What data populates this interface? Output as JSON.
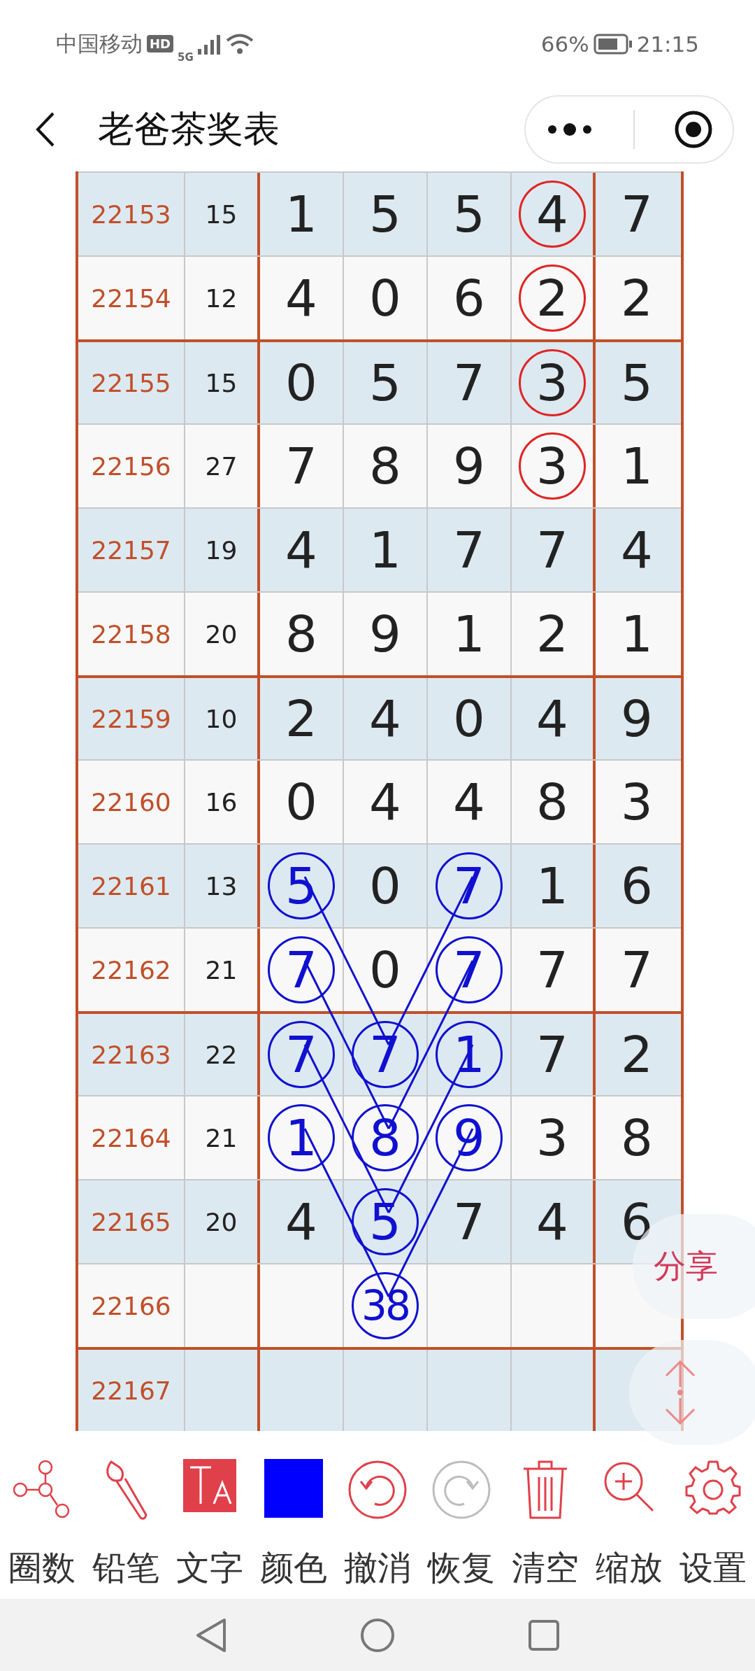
{
  "status_bar": {
    "carrier": "中国移动",
    "network_badge": "HD",
    "network_type": "5G",
    "battery": "66%",
    "time": "21:15"
  },
  "nav": {
    "title": "老爸茶奖表"
  },
  "table": {
    "rows": [
      {
        "period": "22153",
        "sum": "15",
        "digits": [
          {
            "text": "1",
            "circled": false
          },
          {
            "text": "5",
            "circled": false
          },
          {
            "text": "5",
            "circled": false
          },
          {
            "text": "4",
            "circled": true,
            "color": "#e02424"
          },
          {
            "text": "7",
            "circled": false
          }
        ]
      },
      {
        "period": "22154",
        "sum": "12",
        "digits": [
          {
            "text": "4",
            "circled": false
          },
          {
            "text": "0",
            "circled": false
          },
          {
            "text": "6",
            "circled": false
          },
          {
            "text": "2",
            "circled": true,
            "color": "#e02424"
          },
          {
            "text": "2",
            "circled": false
          }
        ]
      },
      {
        "period": "22155",
        "sum": "15",
        "digits": [
          {
            "text": "0",
            "circled": false
          },
          {
            "text": "5",
            "circled": false
          },
          {
            "text": "7",
            "circled": false
          },
          {
            "text": "3",
            "circled": true,
            "color": "#e02424"
          },
          {
            "text": "5",
            "circled": false
          }
        ]
      },
      {
        "period": "22156",
        "sum": "27",
        "digits": [
          {
            "text": "7",
            "circled": false
          },
          {
            "text": "8",
            "circled": false
          },
          {
            "text": "9",
            "circled": false
          },
          {
            "text": "3",
            "circled": true,
            "color": "#e02424"
          },
          {
            "text": "1",
            "circled": false
          }
        ]
      },
      {
        "period": "22157",
        "sum": "19",
        "digits": [
          {
            "text": "4",
            "circled": false
          },
          {
            "text": "1",
            "circled": false
          },
          {
            "text": "7",
            "circled": false
          },
          {
            "text": "7",
            "circled": false
          },
          {
            "text": "4",
            "circled": false
          }
        ]
      },
      {
        "period": "22158",
        "sum": "20",
        "digits": [
          {
            "text": "8",
            "circled": false
          },
          {
            "text": "9",
            "circled": false
          },
          {
            "text": "1",
            "circled": false
          },
          {
            "text": "2",
            "circled": false
          },
          {
            "text": "1",
            "circled": false
          }
        ]
      },
      {
        "period": "22159",
        "sum": "10",
        "digits": [
          {
            "text": "2",
            "circled": false
          },
          {
            "text": "4",
            "circled": false
          },
          {
            "text": "0",
            "circled": false
          },
          {
            "text": "4",
            "circled": false
          },
          {
            "text": "9",
            "circled": false
          }
        ]
      },
      {
        "period": "22160",
        "sum": "16",
        "digits": [
          {
            "text": "0",
            "circled": false
          },
          {
            "text": "4",
            "circled": false
          },
          {
            "text": "4",
            "circled": false
          },
          {
            "text": "8",
            "circled": false
          },
          {
            "text": "3",
            "circled": false
          }
        ]
      },
      {
        "period": "22161",
        "sum": "13",
        "digits": [
          {
            "text": "5",
            "circled": true,
            "color": "#1010d0"
          },
          {
            "text": "0",
            "circled": false
          },
          {
            "text": "7",
            "circled": true,
            "color": "#1010d0"
          },
          {
            "text": "1",
            "circled": false
          },
          {
            "text": "6",
            "circled": false
          }
        ]
      },
      {
        "period": "22162",
        "sum": "21",
        "digits": [
          {
            "text": "7",
            "circled": true,
            "color": "#1010d0"
          },
          {
            "text": "0",
            "circled": false
          },
          {
            "text": "7",
            "circled": true,
            "color": "#1010d0"
          },
          {
            "text": "7",
            "circled": false
          },
          {
            "text": "7",
            "circled": false
          }
        ]
      },
      {
        "period": "22163",
        "sum": "22",
        "digits": [
          {
            "text": "7",
            "circled": true,
            "color": "#1010d0"
          },
          {
            "text": "7",
            "circled": true,
            "color": "#1010d0"
          },
          {
            "text": "1",
            "circled": true,
            "color": "#1010d0"
          },
          {
            "text": "7",
            "circled": false
          },
          {
            "text": "2",
            "circled": false
          }
        ]
      },
      {
        "period": "22164",
        "sum": "21",
        "digits": [
          {
            "text": "1",
            "circled": true,
            "color": "#1010d0"
          },
          {
            "text": "8",
            "circled": true,
            "color": "#1010d0"
          },
          {
            "text": "9",
            "circled": true,
            "color": "#1010d0"
          },
          {
            "text": "3",
            "circled": false
          },
          {
            "text": "8",
            "circled": false
          }
        ]
      },
      {
        "period": "22165",
        "sum": "20",
        "digits": [
          {
            "text": "4",
            "circled": false
          },
          {
            "text": "5",
            "circled": true,
            "color": "#1010d0"
          },
          {
            "text": "7",
            "circled": false
          },
          {
            "text": "4",
            "circled": false
          },
          {
            "text": "6",
            "circled": false
          }
        ]
      },
      {
        "period": "22166",
        "digits": [
          {
            "circled": false
          },
          {
            "text": "38",
            "circled": true,
            "color": "#1010d0"
          },
          {
            "circled": false
          },
          {
            "circled": false
          },
          {
            "circled": false
          }
        ]
      },
      {
        "period": "22167",
        "digits": [
          {
            "circled": false
          },
          {
            "circled": false
          },
          {
            "circled": false
          },
          {
            "circled": false
          },
          {
            "circled": false
          }
        ]
      }
    ]
  },
  "float_share": {
    "label": "分享"
  },
  "toolbar": [
    {
      "label": "圈数",
      "disabled": false
    },
    {
      "label": "铅笔",
      "disabled": false
    },
    {
      "label": "文字",
      "disabled": false
    },
    {
      "label": "颜色",
      "disabled": false,
      "color": "#0000ff"
    },
    {
      "label": "撤消",
      "disabled": false
    },
    {
      "label": "恢复",
      "disabled": true
    },
    {
      "label": "清空",
      "disabled": false
    },
    {
      "label": "缩放",
      "disabled": false
    },
    {
      "label": "设置",
      "disabled": false
    }
  ]
}
